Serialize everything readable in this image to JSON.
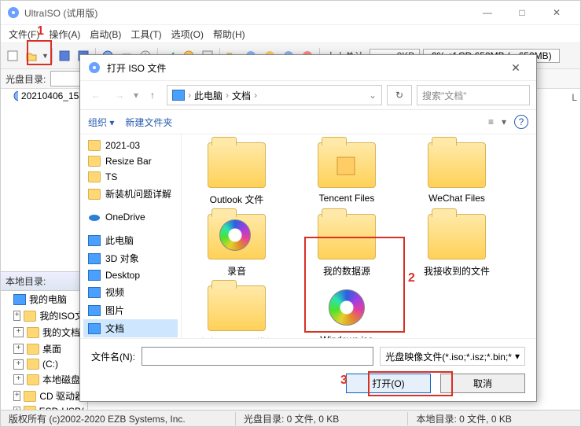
{
  "app": {
    "title": "UltraISO (试用版)",
    "window_buttons": {
      "min": "—",
      "max": "□",
      "close": "✕"
    }
  },
  "menu": {
    "file": "文件(F)",
    "action": "操作(A)",
    "boot": "启动(B)",
    "tool": "工具(T)",
    "option": "选项(O)",
    "help": "帮助(H)"
  },
  "toolbar": {
    "sizetotal_label": "大小总计:",
    "sizetotal_value": "0KB",
    "progress": "0% of CD 650MB ( - 650MB)"
  },
  "diskrow": {
    "label": "光盘目录:",
    "value": ""
  },
  "topfile": "20210406_154",
  "localheader": "本地目录:",
  "localtree": [
    {
      "label": "我的电脑"
    },
    {
      "label": "我的ISO文"
    },
    {
      "label": "我的文档"
    },
    {
      "label": "桌面"
    },
    {
      "label": "(C:)"
    },
    {
      "label": "本地磁盘("
    },
    {
      "label": "CD 驱动器"
    },
    {
      "label": "ESD-USB("
    }
  ],
  "dialog": {
    "title": "打开 ISO 文件",
    "close": "✕",
    "nav": {
      "back": "←",
      "fwd": "→",
      "up": "↑"
    },
    "breadcrumb": {
      "root_icon": "pc",
      "part1": "此电脑",
      "part2": "文档"
    },
    "refresh": "↻",
    "search_placeholder": "搜索\"文档\"",
    "org": "组织",
    "org_arrow": "▾",
    "newfolder": "新建文件夹",
    "viewopts": "≡",
    "help": "?",
    "side": [
      {
        "label": "2021-03",
        "kind": "folder"
      },
      {
        "label": "Resize Bar",
        "kind": "folder"
      },
      {
        "label": "TS",
        "kind": "folder"
      },
      {
        "label": "新装机问题详解",
        "kind": "folder"
      },
      {
        "label": "OneDrive",
        "kind": "cloud"
      },
      {
        "label": "此电脑",
        "kind": "pc"
      },
      {
        "label": "3D 对象",
        "kind": "pc"
      },
      {
        "label": "Desktop",
        "kind": "pc"
      },
      {
        "label": "视频",
        "kind": "pc"
      },
      {
        "label": "图片",
        "kind": "pc"
      },
      {
        "label": "文档",
        "kind": "pc",
        "selected": true
      }
    ],
    "files": [
      {
        "label": "Outlook 文件",
        "kind": "folder"
      },
      {
        "label": "Tencent Files",
        "kind": "folder"
      },
      {
        "label": "WeChat Files",
        "kind": "folder"
      },
      {
        "label": "录音",
        "kind": "folder",
        "hasDisc": true
      },
      {
        "label": "我的数据源",
        "kind": "folder"
      },
      {
        "label": "我接收到的文件",
        "kind": "folder"
      },
      {
        "label": "自定义 Office 模板",
        "kind": "folder"
      },
      {
        "label": "Windows.iso",
        "kind": "iso"
      }
    ],
    "filename_label": "文件名(N):",
    "filename_value": "",
    "filter": "光盘映像文件(*.iso;*.isz;*.bin;*",
    "filter_arrow": "▾",
    "open": "打开(O)",
    "cancel": "取消"
  },
  "status": {
    "copyright": "版权所有 (c)2002-2020 EZB Systems, Inc.",
    "diskdir": "光盘目录: 0 文件, 0 KB",
    "localdir": "本地目录: 0 文件, 0 KB"
  },
  "annotations": {
    "n1": "1",
    "n2": "2",
    "n3": "3"
  },
  "rightcol": {
    "header_text": "L"
  }
}
